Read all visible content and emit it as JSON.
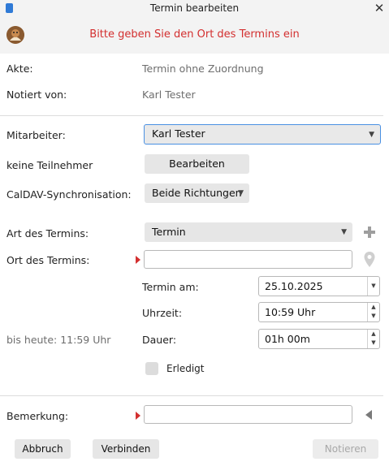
{
  "window": {
    "title": "Termin bearbeiten",
    "close_label": "✕"
  },
  "banner": {
    "message": "Bitte geben Sie den Ort des Termins ein"
  },
  "info": {
    "akte_label": "Akte:",
    "akte_value": "Termin ohne Zuordnung",
    "notiert_label": "Notiert von:",
    "notiert_value": "Karl Tester"
  },
  "form": {
    "mitarbeiter_label": "Mitarbeiter:",
    "mitarbeiter_value": "Karl Tester",
    "teilnehmer_label": "keine Teilnehmer",
    "bearbeiten_button": "Bearbeiten",
    "caldav_label": "CalDAV-Synchronisation:",
    "caldav_value": "Beide Richtungen",
    "art_label": "Art des Termins:",
    "art_value": "Termin",
    "ort_label": "Ort des Termins:",
    "ort_value": "",
    "termin_am_label": "Termin am:",
    "termin_am_value": "25.10.2025",
    "uhrzeit_label": "Uhrzeit:",
    "uhrzeit_value": "10:59 Uhr",
    "dauer_label": "Dauer:",
    "dauer_value": "01h 00m",
    "bis_heute_label": "bis heute: 11:59 Uhr",
    "erledigt_label": "Erledigt",
    "bemerkung_label": "Bemerkung:",
    "bemerkung_value": ""
  },
  "footer": {
    "abbruch": "Abbruch",
    "verbinden": "Verbinden",
    "notieren": "Notieren"
  },
  "icons": {
    "add": "plus-icon",
    "location": "map-pin-icon",
    "collapse": "triangle-left-icon"
  }
}
